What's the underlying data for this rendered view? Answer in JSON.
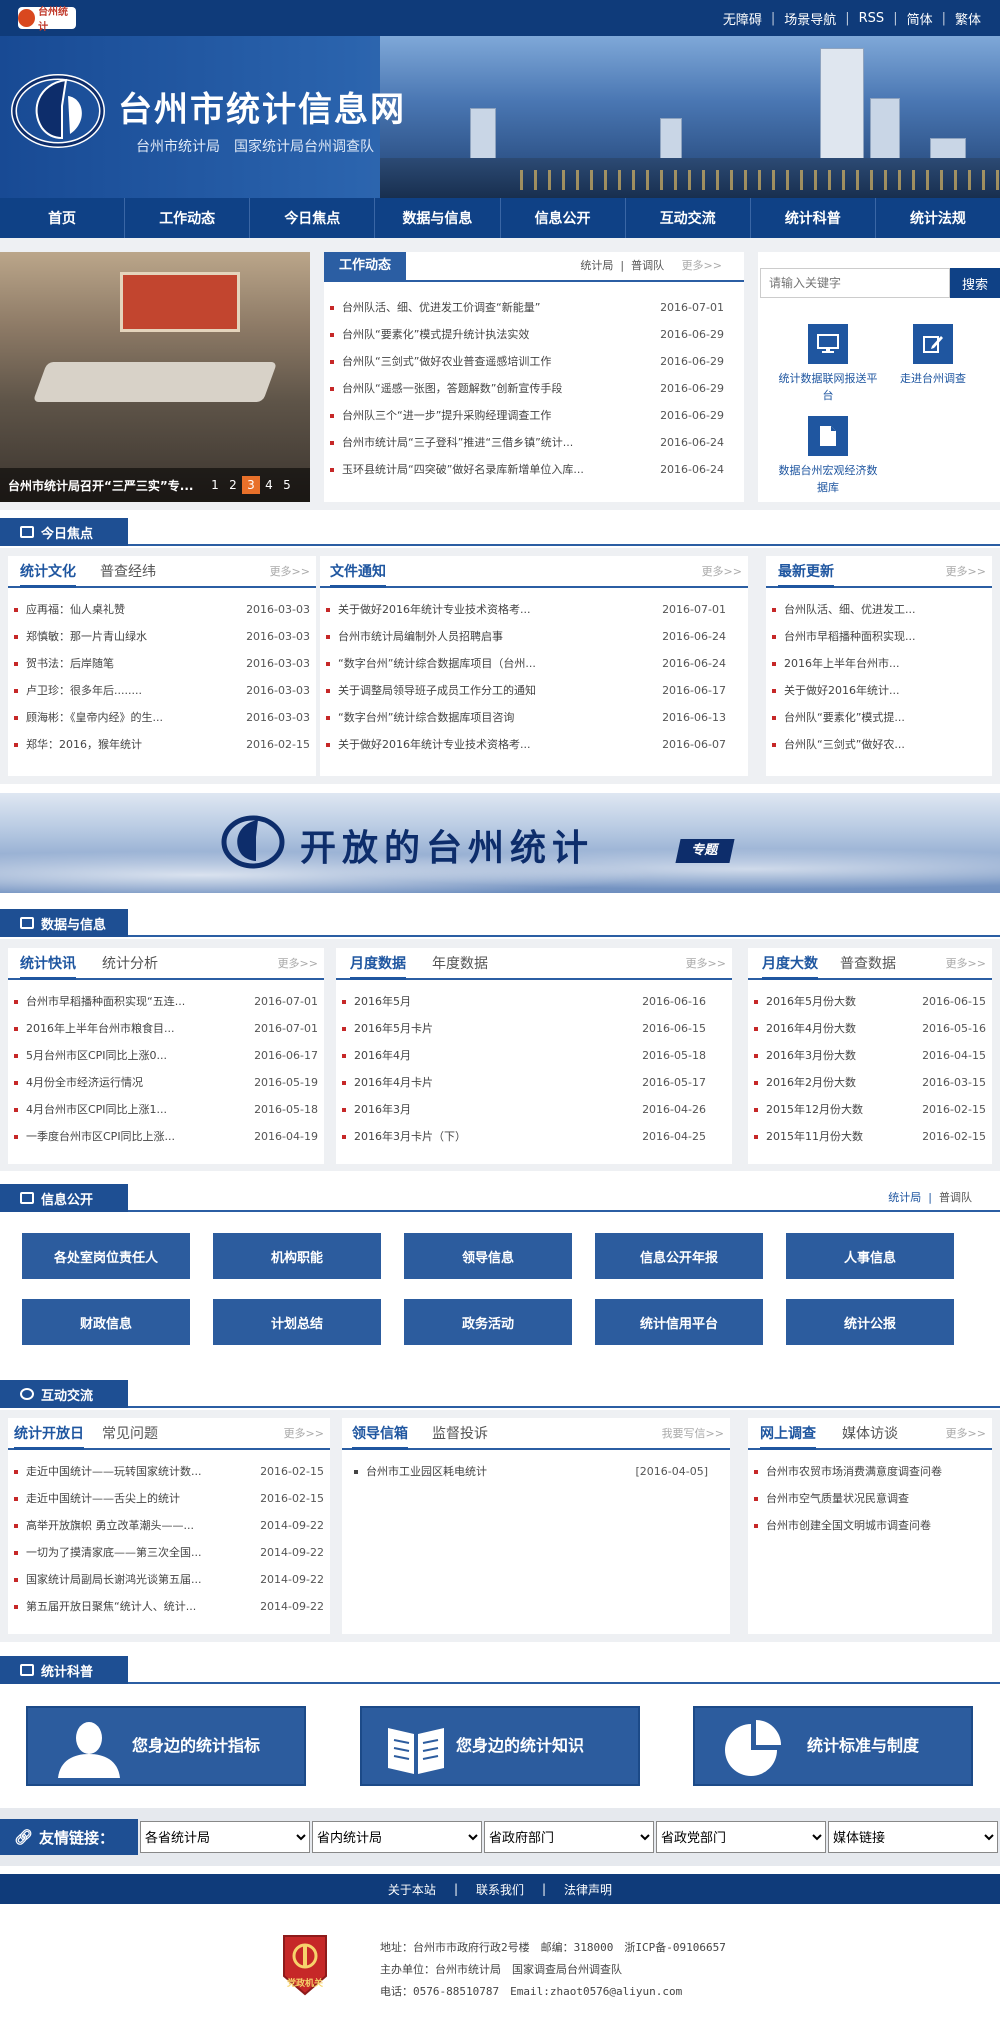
{
  "topbar": {
    "logo_text": "台州统计",
    "links": [
      "无障碍",
      "场景导航",
      "RSS",
      "简体",
      "繁体"
    ]
  },
  "banner": {
    "title": "台州市统计信息网",
    "subtitle": "台州市统计局　国家统计局台州调查队"
  },
  "nav": {
    "items": [
      "首页",
      "工作动态",
      "今日焦点",
      "数据与信息",
      "信息公开",
      "互动交流",
      "统计科普",
      "统计法规"
    ]
  },
  "slideshow": {
    "caption": "台州市统计局召开“三严三实”专...",
    "pages": [
      "1",
      "2",
      "3",
      "4",
      "5"
    ],
    "active": 2
  },
  "work_news": {
    "title": "工作动态",
    "tabs": [
      "统计局",
      "普调队"
    ],
    "more": "更多>>",
    "items": [
      {
        "t": "台州队活、细、优进发工价调查“新能量”",
        "d": "2016-07-01"
      },
      {
        "t": "台州队“要素化”模式提升统计执法实效",
        "d": "2016-06-29"
      },
      {
        "t": "台州队“三剑式”做好农业普查遥感培训工作",
        "d": "2016-06-29"
      },
      {
        "t": "台州队“遥感一张图，答题解数”创新宣传手段",
        "d": "2016-06-29"
      },
      {
        "t": "台州队三个“进一步”提升采购经理调查工作",
        "d": "2016-06-29"
      },
      {
        "t": "台州市统计局“三子登科”推进“三借乡镇”统计...",
        "d": "2016-06-24"
      },
      {
        "t": "玉环县统计局“四突破”做好名录库新增单位入库...",
        "d": "2016-06-24"
      }
    ]
  },
  "search": {
    "placeholder": "请输入关键字",
    "button": "搜索"
  },
  "quick_links": [
    {
      "label": "统计数据联网报送平台",
      "icon": "monitor-icon"
    },
    {
      "label": "走进台州调查",
      "icon": "edit-icon"
    },
    {
      "label": "数据台州宏观经济数据库",
      "icon": "document-icon"
    }
  ],
  "focus": {
    "section": "今日焦点",
    "col1": {
      "tabs": [
        "统计文化",
        "普查经纬"
      ],
      "more": "更多>>",
      "items": [
        {
          "t": "应再福：仙人桌礼赞",
          "d": "2016-03-03"
        },
        {
          "t": "郑慎敏：那一片青山绿水",
          "d": "2016-03-03"
        },
        {
          "t": "贺书法：后岸随笔",
          "d": "2016-03-03"
        },
        {
          "t": "卢卫珍：很多年后........",
          "d": "2016-03-03"
        },
        {
          "t": "顾海彬：《皇帝内经》的生...",
          "d": "2016-03-03"
        },
        {
          "t": "郑华：2016，猴年统计",
          "d": "2016-02-15"
        }
      ]
    },
    "col2": {
      "tabs": [
        "文件通知"
      ],
      "more": "更多>>",
      "items": [
        {
          "t": "关于做好2016年统计专业技术资格考...",
          "d": "2016-07-01"
        },
        {
          "t": "台州市统计局编制外人员招聘启事",
          "d": "2016-06-24"
        },
        {
          "t": "“数字台州”统计综合数据库项目（台州...",
          "d": "2016-06-24"
        },
        {
          "t": "关于调整局领导班子成员工作分工的通知",
          "d": "2016-06-17"
        },
        {
          "t": "“数字台州”统计综合数据库项目咨询",
          "d": "2016-06-13"
        },
        {
          "t": "关于做好2016年统计专业技术资格考...",
          "d": "2016-06-07"
        }
      ]
    },
    "col3": {
      "tabs": [
        "最新更新"
      ],
      "more": "更多>>",
      "items": [
        {
          "t": "台州队活、细、优进发工..."
        },
        {
          "t": "台州市早稻播种面积实现..."
        },
        {
          "t": "2016年上半年台州市..."
        },
        {
          "t": "关于做好2016年统计..."
        },
        {
          "t": "台州队“要素化”模式提..."
        },
        {
          "t": "台州队“三剑式”做好农..."
        }
      ]
    }
  },
  "special": {
    "title": "开放的台州统计",
    "tag": "专题"
  },
  "data_info": {
    "section": "数据与信息",
    "col1": {
      "tabs": [
        "统计快讯",
        "统计分析"
      ],
      "more": "更多>>",
      "items": [
        {
          "t": "台州市早稻播种面积实现“五连...",
          "d": "2016-07-01"
        },
        {
          "t": "2016年上半年台州市粮食目...",
          "d": "2016-07-01"
        },
        {
          "t": "5月台州市区CPI同比上涨0...",
          "d": "2016-06-17"
        },
        {
          "t": "4月份全市经济运行情况",
          "d": "2016-05-19"
        },
        {
          "t": "4月台州市区CPI同比上涨1...",
          "d": "2016-05-18"
        },
        {
          "t": "一季度台州市区CPI同比上涨...",
          "d": "2016-04-19"
        }
      ]
    },
    "col2": {
      "tabs": [
        "月度数据",
        "年度数据"
      ],
      "more": "更多>>",
      "items": [
        {
          "t": "2016年5月",
          "d": "2016-06-16"
        },
        {
          "t": "2016年5月卡片",
          "d": "2016-06-15"
        },
        {
          "t": "2016年4月",
          "d": "2016-05-18"
        },
        {
          "t": "2016年4月卡片",
          "d": "2016-05-17"
        },
        {
          "t": "2016年3月",
          "d": "2016-04-26"
        },
        {
          "t": "2016年3月卡片（下）",
          "d": "2016-04-25"
        }
      ]
    },
    "col3": {
      "tabs": [
        "月度大数",
        "普查数据"
      ],
      "more": "更多>>",
      "items": [
        {
          "t": "2016年5月份大数",
          "d": "2016-06-15"
        },
        {
          "t": "2016年4月份大数",
          "d": "2016-05-16"
        },
        {
          "t": "2016年3月份大数",
          "d": "2016-04-15"
        },
        {
          "t": "2016年2月份大数",
          "d": "2016-03-15"
        },
        {
          "t": "2015年12月份大数",
          "d": "2016-02-15"
        },
        {
          "t": "2015年11月份大数",
          "d": "2016-02-15"
        }
      ]
    }
  },
  "disclosure": {
    "section": "信息公开",
    "right_tabs": [
      "统计局",
      "普调队"
    ],
    "buttons": [
      "各处室岗位责任人",
      "机构职能",
      "领导信息",
      "信息公开年报",
      "人事信息",
      "财政信息",
      "计划总结",
      "政务活动",
      "统计信用平台",
      "统计公报"
    ]
  },
  "interact": {
    "section": "互动交流",
    "col1": {
      "tabs": [
        "统计开放日",
        "常见问题"
      ],
      "more": "更多>>",
      "items": [
        {
          "t": "走近中国统计——玩转国家统计数...",
          "d": "2016-02-15"
        },
        {
          "t": "走近中国统计——舌尖上的统计",
          "d": "2016-02-15"
        },
        {
          "t": "高举开放旗帜 勇立改革潮头——...",
          "d": "2014-09-22"
        },
        {
          "t": "一切为了摸清家底——第三次全国...",
          "d": "2014-09-22"
        },
        {
          "t": "国家统计局副局长谢鸿光谈第五届...",
          "d": "2014-09-22"
        },
        {
          "t": "第五届开放日聚焦“统计人、统计...",
          "d": "2014-09-22"
        }
      ]
    },
    "col2": {
      "tabs": [
        "领导信箱",
        "监督投诉"
      ],
      "more": "我要写信>>",
      "items": [
        {
          "t": "台州市工业园区耗电统计",
          "d": "[2016-04-05]"
        }
      ]
    },
    "col3": {
      "tabs": [
        "网上调查",
        "媒体访谈"
      ],
      "more": "更多>>",
      "items": [
        {
          "t": "台州市农贸市场消费满意度调查问卷"
        },
        {
          "t": "台州市空气质量状况民意调查"
        },
        {
          "t": "台州市创建全国文明城市调查问卷"
        }
      ]
    }
  },
  "science": {
    "section": "统计科普",
    "cards": [
      {
        "label": "您身边的统计指标",
        "icon": "person-icon"
      },
      {
        "label": "您身边的统计知识",
        "icon": "book-icon"
      },
      {
        "label": "统计标准与制度",
        "icon": "pie-chart-icon"
      }
    ]
  },
  "friend_links": {
    "title": "友情链接：",
    "selects": [
      "各省统计局",
      "省内统计局",
      "省政府部门",
      "省政党部门",
      "媒体链接"
    ]
  },
  "footer": {
    "links": [
      "关于本站",
      "联系我们",
      "法律声明"
    ],
    "badge": "党政机关",
    "lines": [
      "地址：台州市市政府行政2号楼　邮编：318000　浙ICP备-09106657",
      "主办单位：台州市统计局　国家调查局台州调查队",
      "电话：0576-88510787　Email:zhaot0576@aliyun.com"
    ]
  },
  "colors": {
    "primary": "#0f4186",
    "accent": "#c62828",
    "button": "#2c5c9e"
  }
}
